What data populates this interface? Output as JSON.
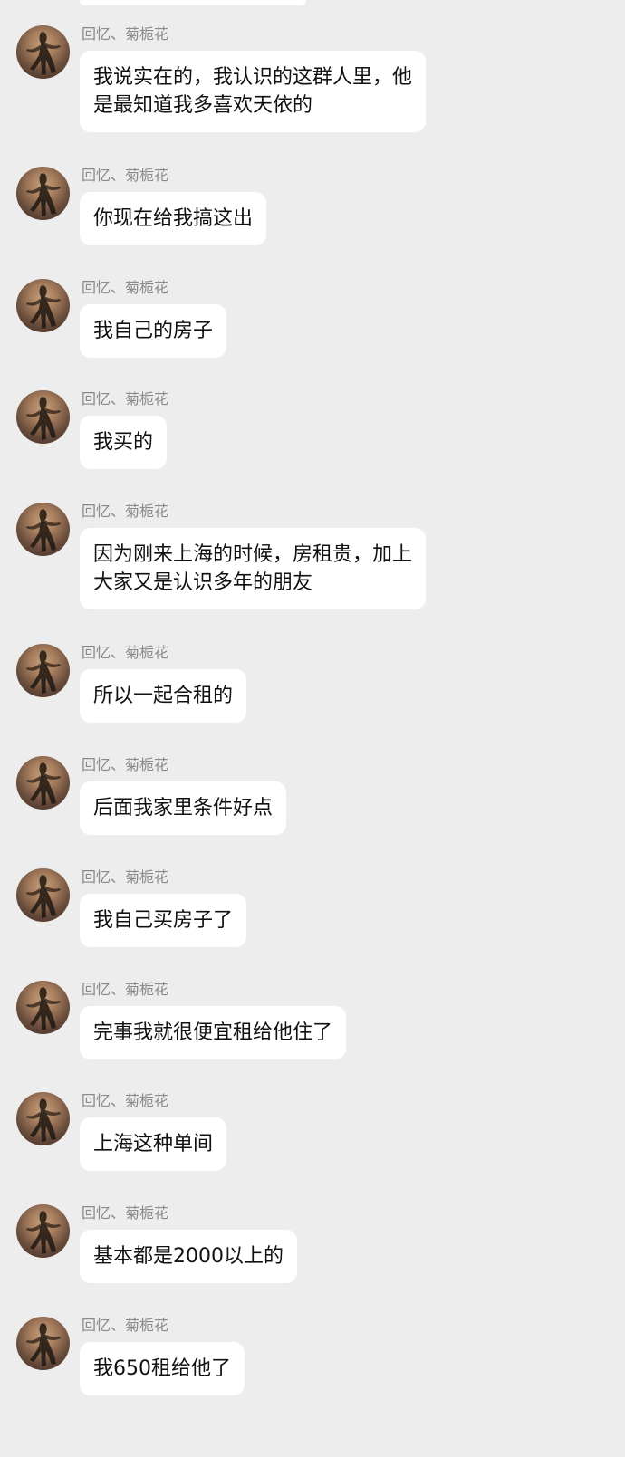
{
  "chat": {
    "messages": [
      {
        "sender": "回忆、菊栀花",
        "text": "我说实在的，我认识的这群人里，他\n是最知道我多喜欢天依的"
      },
      {
        "sender": "回忆、菊栀花",
        "text": "你现在给我搞这出"
      },
      {
        "sender": "回忆、菊栀花",
        "text": "我自己的房子"
      },
      {
        "sender": "回忆、菊栀花",
        "text": "我买的"
      },
      {
        "sender": "回忆、菊栀花",
        "text": "因为刚来上海的时候，房租贵，加上\n大家又是认识多年的朋友"
      },
      {
        "sender": "回忆、菊栀花",
        "text": "所以一起合租的"
      },
      {
        "sender": "回忆、菊栀花",
        "text": "后面我家里条件好点"
      },
      {
        "sender": "回忆、菊栀花",
        "text": "我自己买房子了"
      },
      {
        "sender": "回忆、菊栀花",
        "text": "完事我就很便宜租给他住了"
      },
      {
        "sender": "回忆、菊栀花",
        "text": "上海这种单间"
      },
      {
        "sender": "回忆、菊栀花",
        "text": "基本都是2000以上的"
      },
      {
        "sender": "回忆、菊栀花",
        "text": "我650租给他了"
      }
    ]
  }
}
